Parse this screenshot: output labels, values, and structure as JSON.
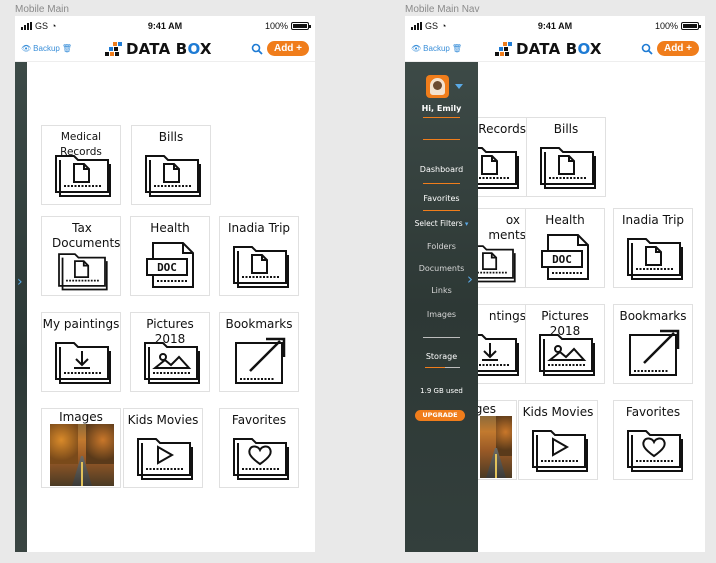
{
  "artboards": [
    {
      "label": "Mobile Main"
    },
    {
      "label": "Mobile Main Nav"
    }
  ],
  "status_bar": {
    "carrier": "GS",
    "time": "9:41 AM",
    "battery": "100%"
  },
  "header": {
    "backup_label": "Backup",
    "logo_text_1": "DATA B",
    "logo_text_o": "O",
    "logo_text_2": "X",
    "add_label": "Add +"
  },
  "sidebar": {
    "greeting": "Hi, Emily",
    "dashboard": "Dashboard",
    "favorites": "Favorites",
    "select_filters": "Select Filters",
    "filters": [
      "Folders",
      "Documents",
      "Links",
      "Images"
    ],
    "storage": "Storage",
    "storage_used": "1.9 GB used",
    "upgrade": "UPGRADE"
  },
  "main_tiles": [
    {
      "label": "Medical Records",
      "icon": "doc-folder-icon"
    },
    {
      "label": "Bills",
      "icon": "doc-folder-icon"
    },
    {
      "label": "Tax Documents",
      "icon": "doc-folder-icon"
    },
    {
      "label": "Health",
      "icon": "doc-file-icon"
    },
    {
      "label": "Inadia Trip",
      "icon": "doc-folder-icon"
    },
    {
      "label": "My paintings",
      "icon": "download-folder-icon"
    },
    {
      "label": "Pictures 2018",
      "icon": "image-folder-icon"
    },
    {
      "label": "Bookmarks",
      "icon": "link-arrow-icon"
    },
    {
      "label": "Images",
      "icon": "photo-thumbnail"
    },
    {
      "label": "Kids Movies",
      "icon": "play-folder-icon"
    },
    {
      "label": "Favorites",
      "icon": "heart-folder-icon"
    }
  ],
  "nav_tiles": [
    {
      "label": "Records"
    },
    {
      "label": "Bills"
    },
    {
      "label": "ox"
    },
    {
      "label": "ments"
    },
    {
      "label": "Health"
    },
    {
      "label": "Inadia Trip"
    },
    {
      "label": "ntings"
    },
    {
      "label": "Pictures 2018"
    },
    {
      "label": "Bookmarks"
    },
    {
      "label": "ges"
    },
    {
      "label": "Kids Movies"
    },
    {
      "label": "Favorites"
    }
  ],
  "colors": {
    "accent": "#f07d1b",
    "blue": "#1e7bd4",
    "link": "#3a8fd9",
    "sidebar": "#2d3835"
  }
}
